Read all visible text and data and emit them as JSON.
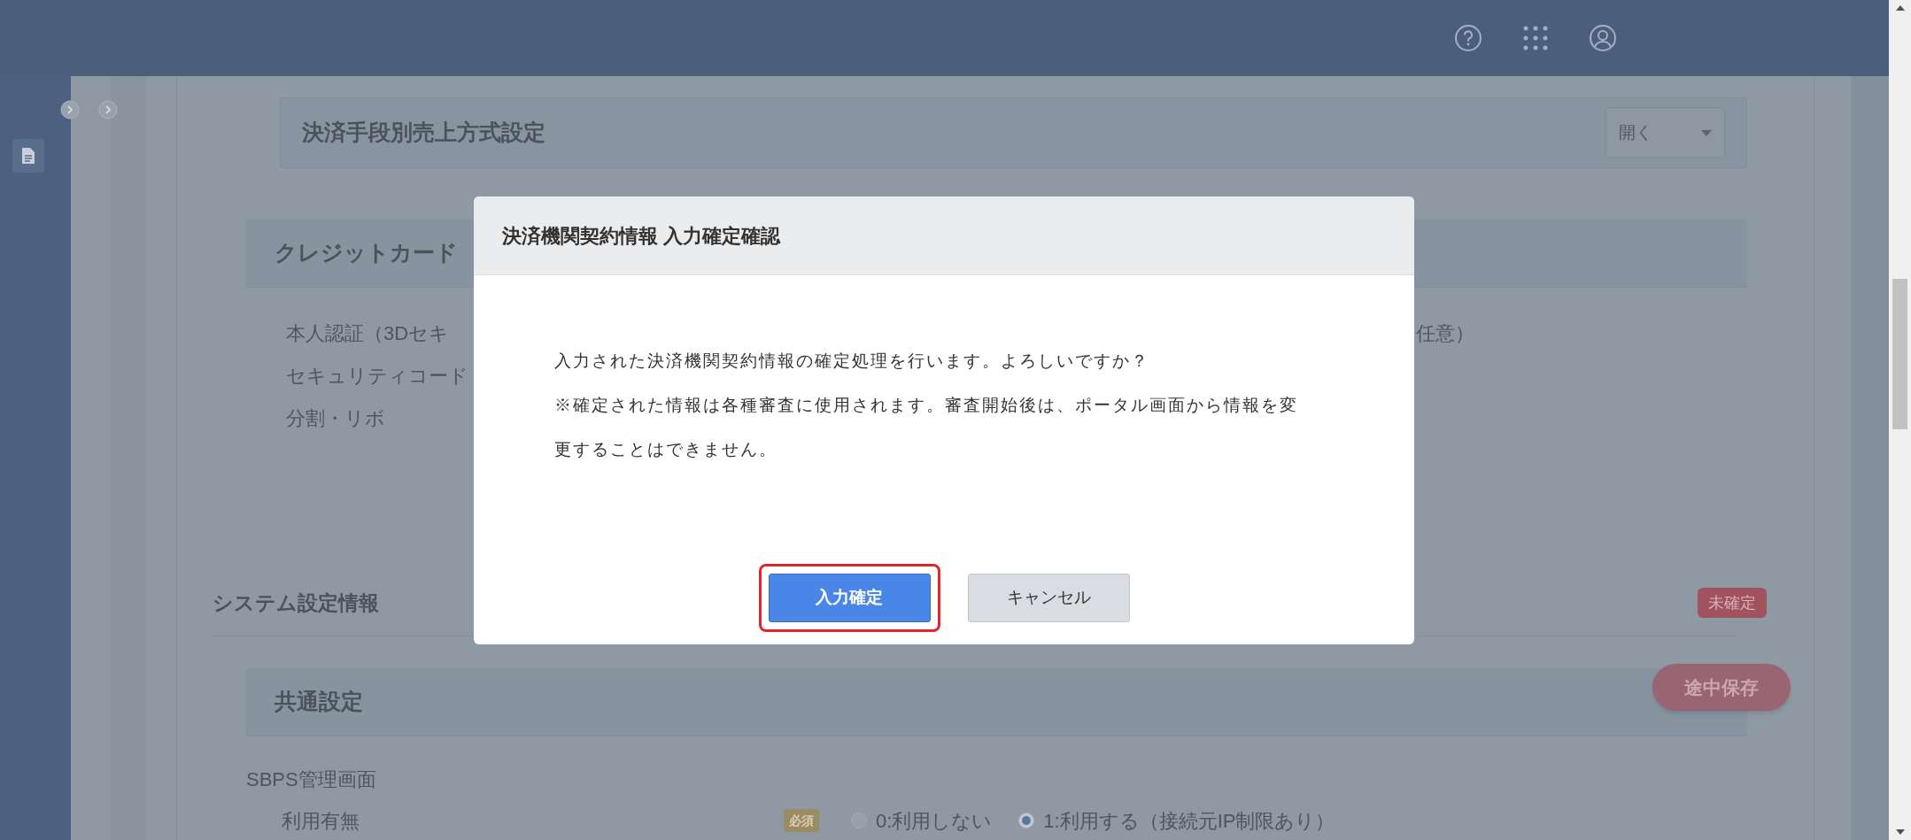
{
  "page": {
    "sales_method_section": {
      "title": "決済手段別売上方式設定",
      "dropdown": "開く"
    },
    "credit_card_section": {
      "title": "クレジットカード",
      "rows": [
        {
          "label": "本人認証（3Dセキ"
        },
        {
          "label": "セキュリティコード"
        },
        {
          "label": "分割・リボ"
        }
      ],
      "right_fragment": "任意）"
    },
    "system_settings": {
      "title": "システム設定情報",
      "status_badge": "未確定"
    },
    "save_draft_button": "途中保存",
    "common_settings": {
      "title": "共通設定",
      "group_label": "SBPS管理画面",
      "field_label": "利用有無",
      "required_badge": "必須",
      "options": [
        {
          "label": "0:利用しない",
          "selected": false
        },
        {
          "label": "1:利用する（接続元IP制限あり）",
          "selected": true
        }
      ]
    }
  },
  "dialog": {
    "title": "決済機関契約情報 入力確定確認",
    "paragraphs": [
      "入力された決済機関契約情報の確定処理を行います。よろしいですか？",
      "※確定された情報は各種審査に使用されます。審査開始後は、ポータル画面から情報を変更することはできません。"
    ],
    "buttons": [
      {
        "label": "入力確定",
        "kind": "primary",
        "highlighted": true
      },
      {
        "label": "キャンセル",
        "kind": "secondary",
        "highlighted": false
      }
    ]
  }
}
